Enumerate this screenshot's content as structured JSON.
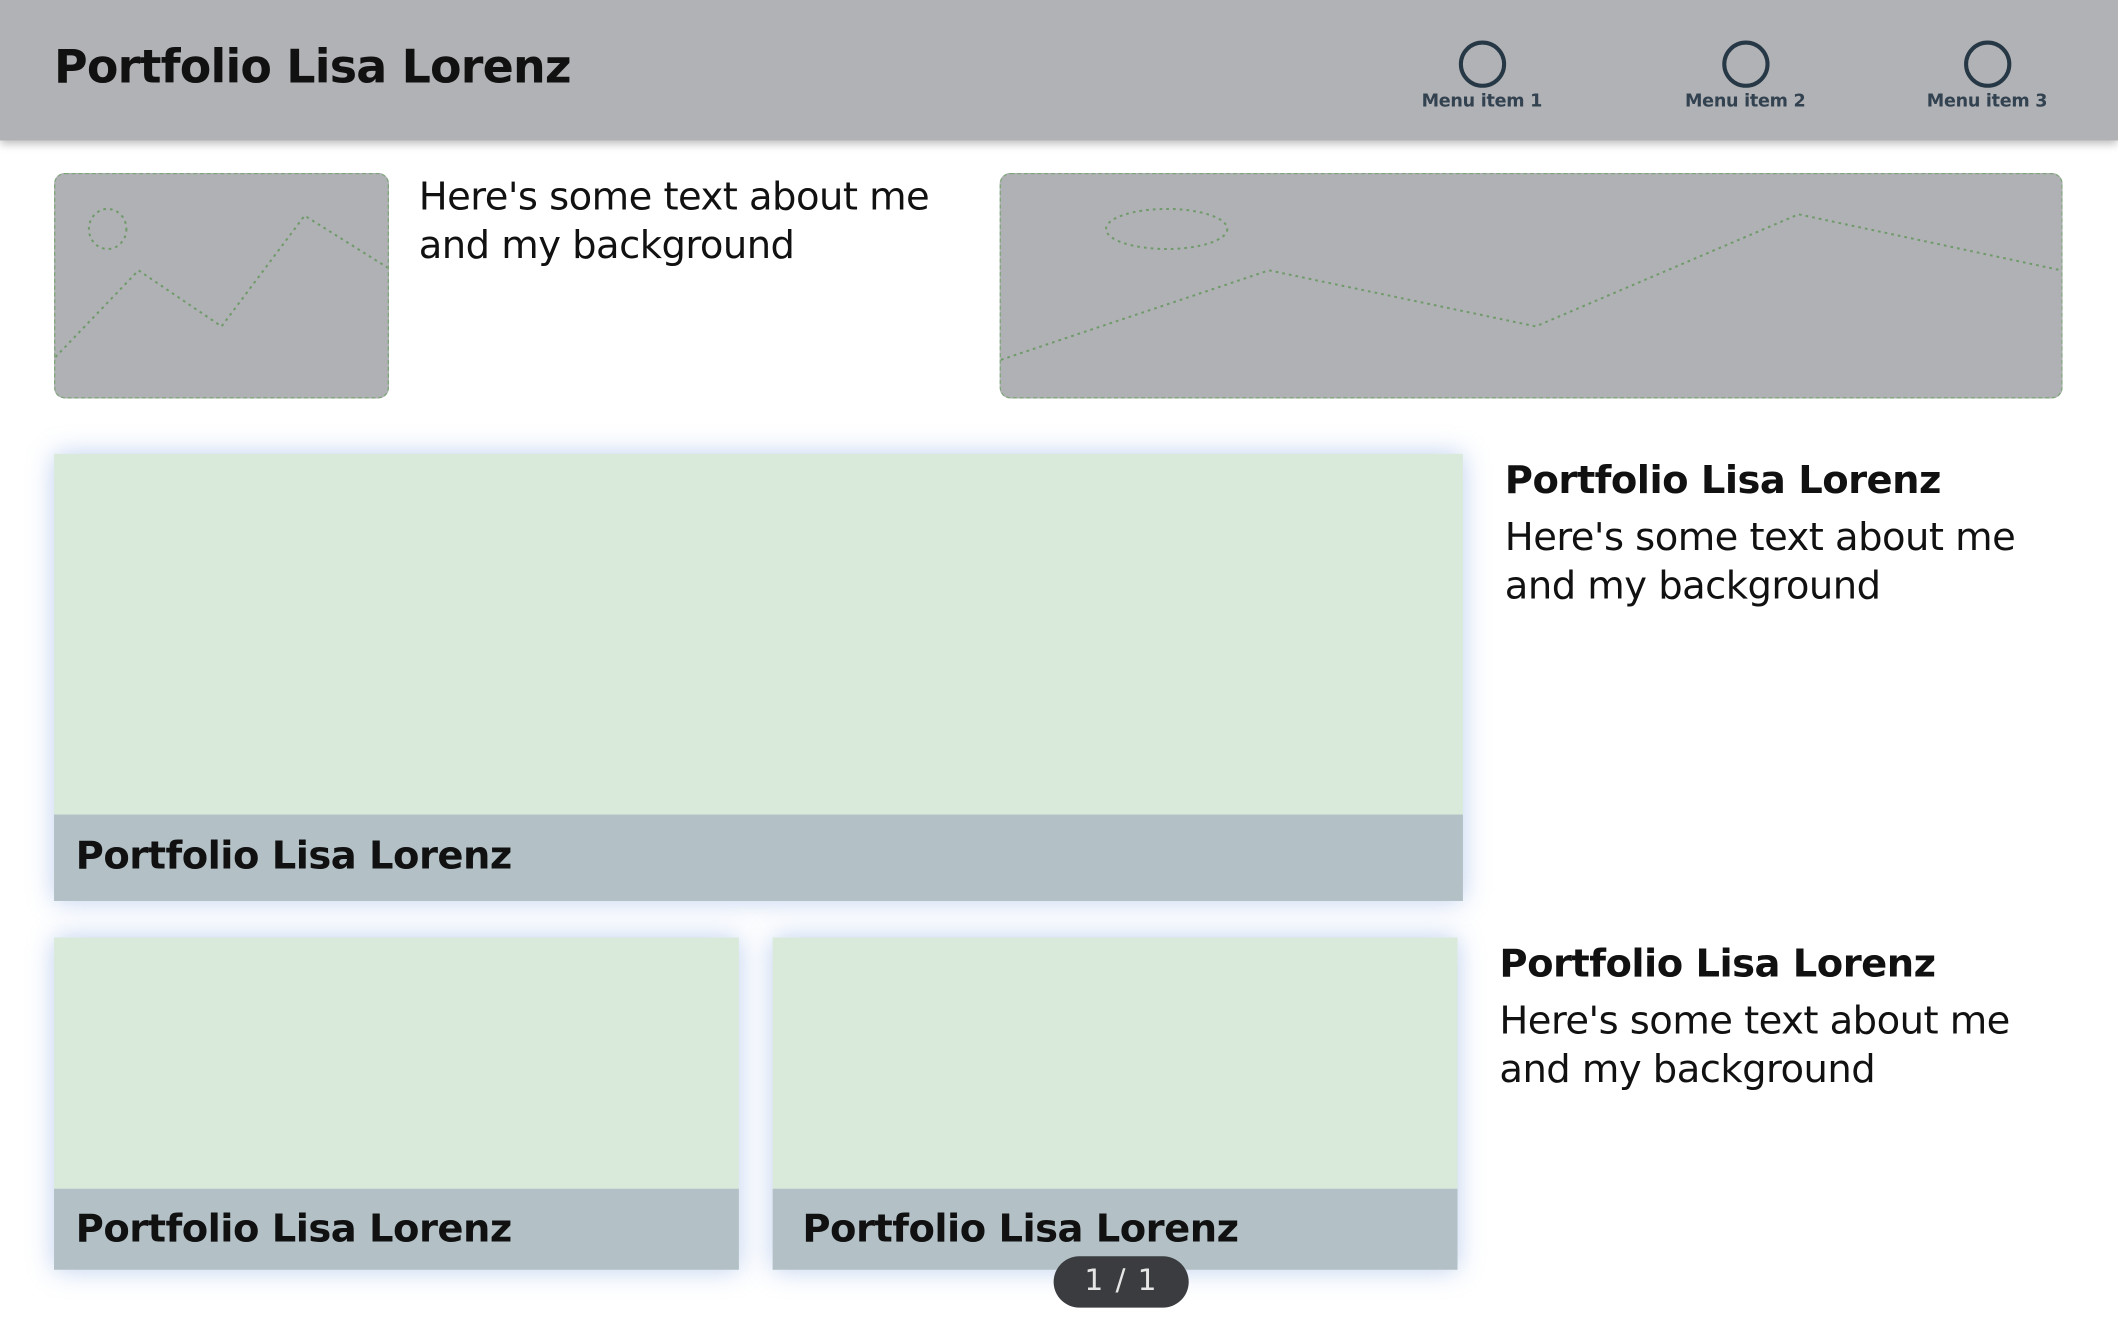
{
  "header": {
    "title": "Portfolio Lisa Lorenz",
    "menu": [
      {
        "label": "Menu item 1"
      },
      {
        "label": "Menu item 2"
      },
      {
        "label": "Menu item 3"
      }
    ]
  },
  "intro": {
    "text": "Here's some text about me and my background"
  },
  "featured_card": {
    "caption": "Portfolio Lisa Lorenz"
  },
  "featured_side": {
    "title": "Portfolio Lisa Lorenz",
    "text": "Here's some text about me and my background"
  },
  "small_cards": [
    {
      "caption": "Portfolio Lisa Lorenz"
    },
    {
      "caption": "Portfolio Lisa Lorenz"
    }
  ],
  "small_side": {
    "title": "Portfolio Lisa Lorenz",
    "text": "Here's some text about me and my background"
  },
  "pager": {
    "text": "1 / 1"
  },
  "colors": {
    "header_bg": "#b1b2b5",
    "card_bg": "#d9eadb",
    "caption_bg": "#b3c1c7",
    "placeholder_bg": "#b0b1b4",
    "icon_stroke": "#263745"
  }
}
